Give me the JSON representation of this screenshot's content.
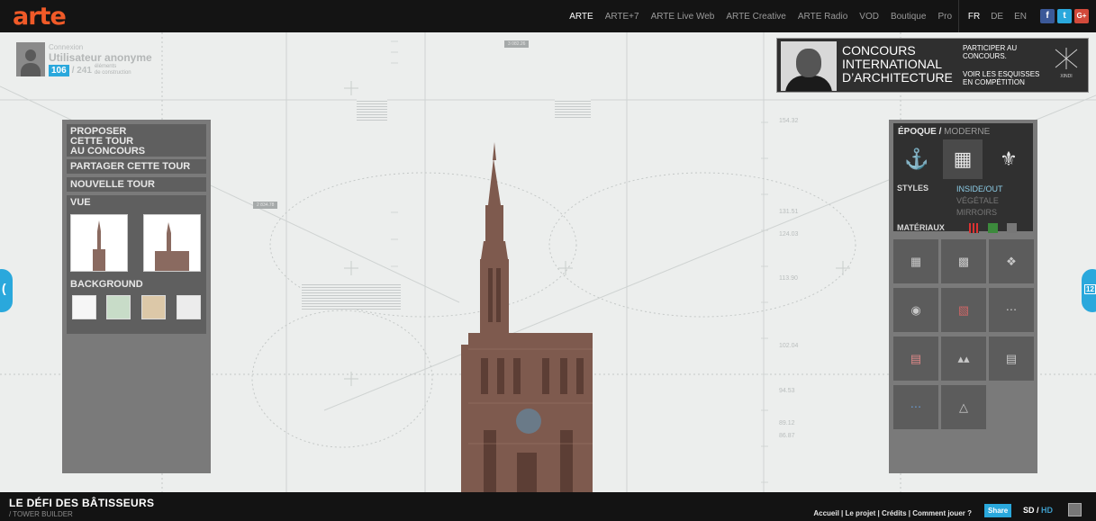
{
  "header": {
    "logo": "arte",
    "nav": [
      "ARTE",
      "ARTE+7",
      "ARTE Live Web",
      "ARTE Creative",
      "ARTE Radio",
      "VOD",
      "Boutique",
      "Pro"
    ],
    "langs": [
      "FR",
      "DE",
      "EN"
    ],
    "social": [
      "f",
      "t",
      "G+"
    ],
    "colors": {
      "brand": "#f05a28",
      "accent": "#2aa8dc",
      "facebook": "#3b5998",
      "twitter": "#2aa8dc",
      "gplus": "#d24a3b"
    }
  },
  "user": {
    "connection_label": "Connexion",
    "name": "Utilisateur anonyme",
    "score": "106",
    "total": "/ 241",
    "score_desc_1": "éléments",
    "score_desc_2": "de construction"
  },
  "banner": {
    "title_1": "CONCOURS",
    "title_2": "INTERNATIONAL",
    "title_3": "D’ARCHITECTURE",
    "cta_1a": "PARTICIPER AU",
    "cta_1b": "CONCOURS.",
    "cta_2a": "VOIR LES ESQUISSES",
    "cta_2b": "EN COMPÉTITION",
    "logo_text": "XINDI"
  },
  "left_panel": {
    "propose_1": "PROPOSER",
    "propose_2": "CETTE TOUR",
    "propose_3": "AU CONCOURS",
    "share": "PARTAGER CETTE TOUR",
    "new_tower": "NOUVELLE TOUR",
    "view": "VUE",
    "background": "BACKGROUND"
  },
  "right_panel": {
    "epoque": "ÉPOQUE /",
    "moderne": " MODERNE",
    "styles_label": "STYLES",
    "styles": [
      "INSIDE/OUT",
      "VÉGÉTALE",
      "MIRROIRS"
    ],
    "materials_label": "MATÉRIAUX"
  },
  "measures": [
    "154.32",
    "131.51",
    "124.03",
    "113.90",
    "102.04",
    "94.53",
    "89.12",
    "86.87"
  ],
  "dim_boxes": [
    "3 082.26",
    "2 834.78"
  ],
  "side_tabs": {
    "left": "(",
    "right": "12"
  },
  "footer": {
    "title": "LE DÉFI DES BÂTISSEURS",
    "subtitle": "/  TOWER BUILDER",
    "links": "Accueil  |  Le projet  |  Crédits  |  Comment jouer ?",
    "share": "Share",
    "sd": "SD",
    "hd": "HD"
  }
}
